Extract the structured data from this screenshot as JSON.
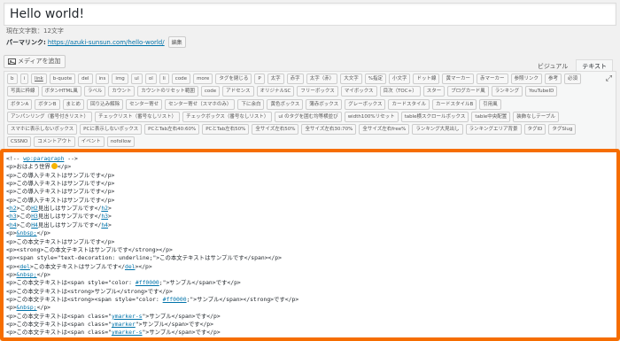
{
  "title": "Hello world!",
  "char_count": "現在文字数：12文字",
  "permalink": {
    "label": "パーマリンク:",
    "url": "https://azuki-sunsun.com/hello-world/",
    "edit": "編集"
  },
  "media_button": "メディアを追加",
  "tabs": [
    "ビジュアル",
    "テキスト"
  ],
  "toolbar_rows": [
    [
      "b",
      "i",
      "link",
      "b-quote",
      "del",
      "ins",
      "img",
      "ul",
      "ol",
      "li",
      "code",
      "more",
      "タグを閉じる",
      "P",
      "太字",
      "赤字",
      "太字（赤）",
      "大文字",
      "%指定",
      "小文字",
      "ドット線",
      "黄マーカー",
      "赤マーカー",
      "参照リンク",
      "参考",
      "必須"
    ],
    [
      "写真に枠線",
      "ボタンHTML風",
      "ラベル",
      "カウント",
      "カウントのリセット範囲",
      "code",
      "アドセンス",
      "オリジナルSC",
      "フリーボックス",
      "マイボックス",
      "目次（TOC+）",
      "スター",
      "ブログカード風",
      "ランキング",
      "YouTubeID"
    ],
    [
      "ボタンA",
      "ボタンB",
      "まとめ",
      "回り込み解除",
      "センター寄せ",
      "センター寄せ（スマホのみ）",
      "下に余白",
      "黄色ボックス",
      "薄赤ボックス",
      "グレーボックス",
      "カードスタイル",
      "カードスタイルB",
      "引用風"
    ],
    [
      "アンパンリング（番号付きリスト）",
      "チェックリスト（番号なしリスト）",
      "チェックボックス（番号なしリスト）",
      "ul のタグを囲む均等横並び",
      "width100%リセット",
      "table横スクロールボックス",
      "table中央配置",
      "装飾なしテーブル"
    ],
    [
      "スマホに表示しないボックス",
      "PCに表示しないボックス",
      "PCとTab左右40:60%",
      "PCとTab左右50%",
      "全サイズ左右50%",
      "全サイズ左右30:70%",
      "全サイズ左右free%",
      "ランキング大見出し",
      "ランキングエリア背景",
      "タグID",
      "タグSlug"
    ],
    [
      "CSSNO",
      "コメントアウト",
      "イベント",
      "nofollow"
    ]
  ],
  "editor_lines": [
    {
      "pre": "<!-- ",
      "mark": "wp:paragraph",
      "post": " -->"
    },
    {
      "pre": "<p>おはよう世界",
      "smile": true,
      "post": "</p>"
    },
    {
      "pre": "<p>この導入テキストはサンプルです</p>"
    },
    {
      "pre": "<p>この導入テキストはサンプルです</p>"
    },
    {
      "pre": "<p>この導入テキストはサンプルです</p>"
    },
    {
      "pre": "<p>この導入テキストはサンプルです</p>"
    },
    {
      "pre": "<",
      "mark": "h2",
      "post": ">この",
      "mark2": "H2",
      "post2": "見出しはサンプルです</",
      "mark3": "h2",
      "post3": ">"
    },
    {
      "pre": "<",
      "mark": "h3",
      "post": ">この",
      "mark2": "H3",
      "post2": "見出しはサンプルです</",
      "mark3": "h3",
      "post3": ">"
    },
    {
      "pre": "<",
      "mark": "h4",
      "post": ">この",
      "mark2": "H4",
      "post2": "見出しはサンプルです</",
      "mark3": "h4",
      "post3": ">"
    },
    {
      "pre": "<p>",
      "mark": "&nbsp;",
      "post": "</p>"
    },
    {
      "pre": "<p>この本文テキストはサンプルです</p>"
    },
    {
      "pre": "<p><strong>この本文テキストはサンプルです</strong></p>"
    },
    {
      "pre": "<p><span style=\"text-decoration: underline;\">この本文テキストはサンプルです</span></p>"
    },
    {
      "pre": "<p><",
      "mark": "del",
      "post": ">この本文テキストはサンプルです</",
      "mark2": "del",
      "post2": "></p>"
    },
    {
      "pre": "<p>",
      "mark": "&nbsp;",
      "post": "</p>"
    },
    {
      "pre": "<p>この本文テキストは<span style=\"color: ",
      "mark": "#ff0000",
      "post": ";\">サンプル</span>です</p>"
    },
    {
      "pre": "<p>この本文テキストは<strong>サンプル</strong>です</p>"
    },
    {
      "pre": "<p>この本文テキストは<strong><span style=\"color: ",
      "mark": "#ff0000",
      "post": ";\">サンプル</span></strong>です</p>"
    },
    {
      "pre": "<p>",
      "mark": "&nbsp;",
      "post": "</p>"
    },
    {
      "pre": "<p>この本文テキストは<span class=\"",
      "mark": "ymarker-s",
      "post": "\">サンプル</span>です</p>"
    },
    {
      "pre": "<p>この本文テキストは<span class=\"",
      "mark": "ymarker",
      "post": "\">サンプル</span>です</p>"
    },
    {
      "pre": "<p>この本文テキストは<span class=\"",
      "mark": "ymarker-s",
      "post": "\">サンプル</span>です</p>"
    }
  ]
}
